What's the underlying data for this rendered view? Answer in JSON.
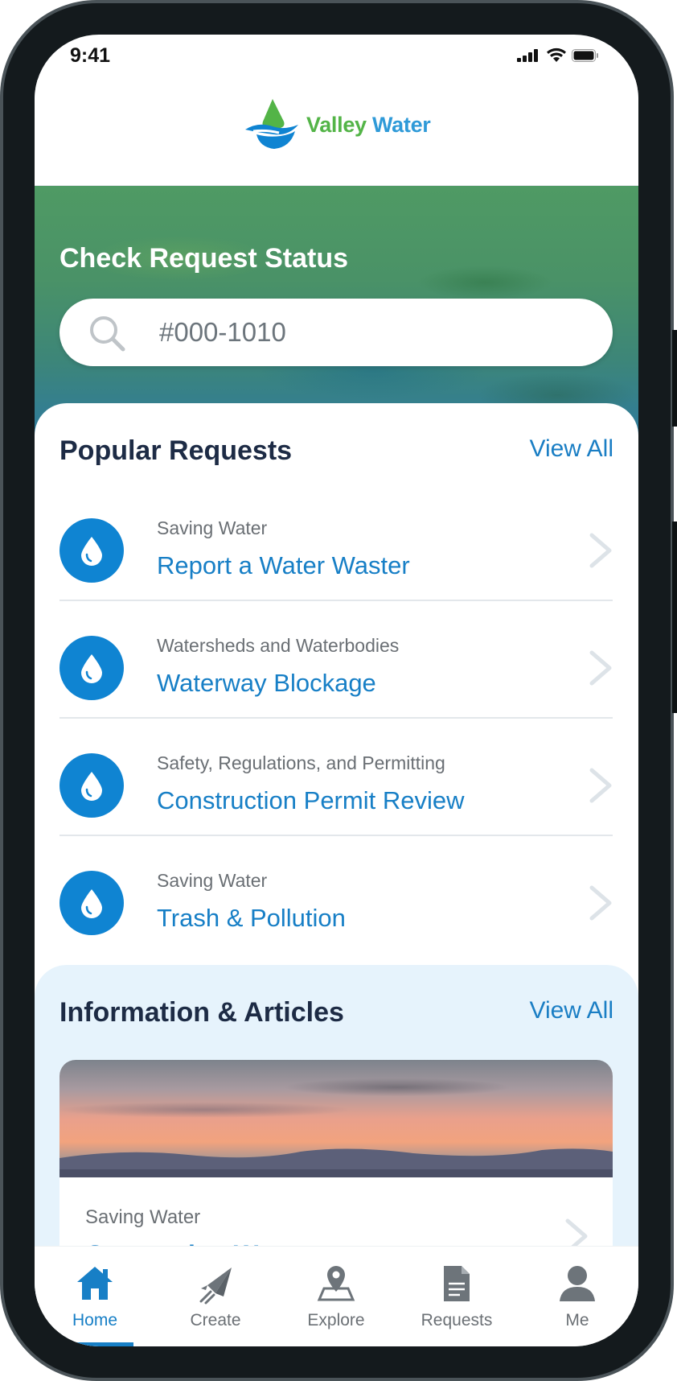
{
  "status_bar": {
    "time": "9:41"
  },
  "header": {
    "logo_text_part1": "Valley",
    "logo_text_part2": " Water",
    "logo_icon": "water-drop-wave-logo-icon"
  },
  "hero": {
    "title": "Check Request Status",
    "search": {
      "value": "",
      "placeholder": "#000-1010",
      "icon": "search-icon"
    }
  },
  "popular": {
    "title": "Popular Requests",
    "view_all": "View All",
    "items": [
      {
        "category": "Saving Water",
        "title": "Report a Water Waster"
      },
      {
        "category": "Watersheds and Waterbodies",
        "title": "Waterway Blockage"
      },
      {
        "category": "Safety, Regulations, and Permitting",
        "title": "Construction Permit Review"
      },
      {
        "category": "Saving Water",
        "title": "Trash & Pollution"
      }
    ]
  },
  "info": {
    "title": "Information & Articles",
    "view_all": "View All",
    "article": {
      "category": "Saving Water",
      "title": "Conserving Water"
    }
  },
  "tabs": [
    {
      "label": "Home",
      "icon": "home-icon",
      "active": true
    },
    {
      "label": "Create",
      "icon": "paper-plane-icon",
      "active": false
    },
    {
      "label": "Explore",
      "icon": "map-pin-icon",
      "active": false
    },
    {
      "label": "Requests",
      "icon": "document-icon",
      "active": false
    },
    {
      "label": "Me",
      "icon": "user-icon",
      "active": false
    }
  ],
  "colors": {
    "accent": "#177fc6",
    "brand_green": "#53b447",
    "heading": "#1d2b45",
    "info_bg": "#e6f3fc"
  }
}
